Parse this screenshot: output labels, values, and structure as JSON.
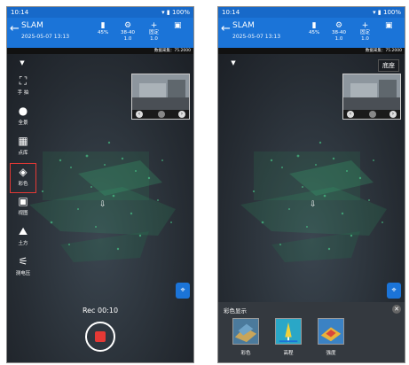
{
  "status_bar": {
    "time": "10:14",
    "battery_text": "100%"
  },
  "app_bar": {
    "title": "SLAM",
    "date": "2025-05-07 13:13",
    "metrics": [
      {
        "top": "",
        "bottom": "45%"
      },
      {
        "top": "38-40",
        "bottom": "1.0"
      },
      {
        "top": "固定",
        "bottom": "1.0"
      },
      {
        "top": "",
        "bottom": ""
      }
    ]
  },
  "info_bar": {
    "text": "数据采集：75.2000"
  },
  "view": {
    "top_button": "底座"
  },
  "toolbar_left": {
    "items": [
      {
        "label": "手 拍",
        "icon": "scan-icon"
      },
      {
        "label": "全景",
        "icon": "globe-icon"
      },
      {
        "label": "点库",
        "icon": "pointlib-icon"
      },
      {
        "label": "彩色",
        "icon": "color-icon",
        "selected": true
      },
      {
        "label": "视图",
        "icon": "view-cube-icon"
      },
      {
        "label": "土方",
        "icon": "earthwork-icon"
      },
      {
        "label": "测电压",
        "icon": "device-icon"
      }
    ]
  },
  "recording": {
    "text": "Rec 00:10"
  },
  "color_panel": {
    "title": "彩色显示",
    "options": [
      {
        "label": "彩色"
      },
      {
        "label": "高程"
      },
      {
        "label": "强度"
      }
    ]
  },
  "colors": {
    "accent": "#1b74d8",
    "record": "#e53935",
    "points": "#2fbf71"
  }
}
